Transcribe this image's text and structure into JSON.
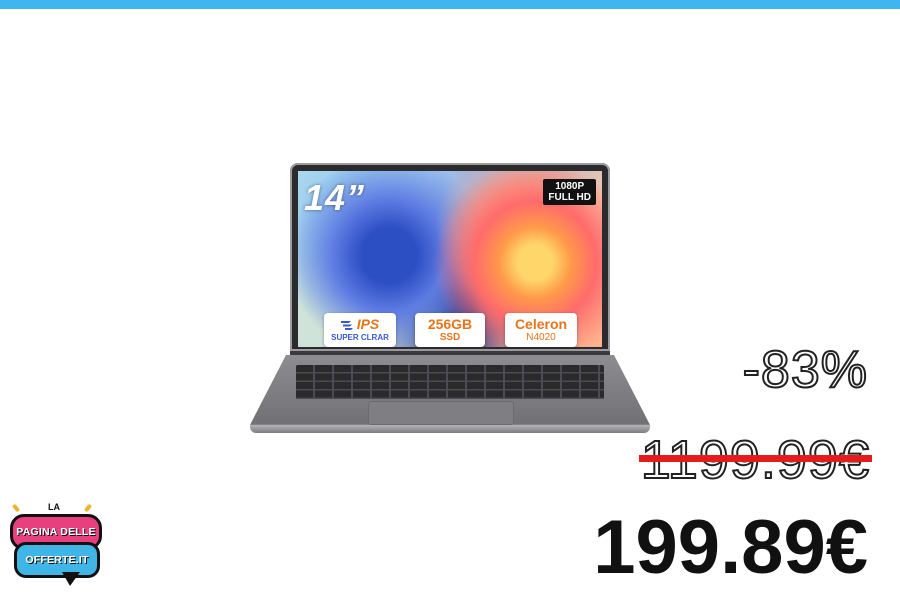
{
  "colors": {
    "top_bar": "#3fb6f0",
    "strike_line": "#e41c1c",
    "logo_pink": "#e8407e",
    "logo_blue": "#3fb6e6"
  },
  "product_image": {
    "screen_size": "14”",
    "resolution_line1": "1080P",
    "resolution_line2": "FULL HD",
    "spec_badges": [
      {
        "icon": "ips-wing-icon",
        "main": "IPS",
        "sub": "SUPER CLRAR"
      },
      {
        "main": "256GB",
        "sub": "SSD"
      },
      {
        "main": "Celeron",
        "sub": "N4020"
      }
    ]
  },
  "pricing": {
    "discount": "-83%",
    "original_price": "1199.99€",
    "sale_price": "199.89€"
  },
  "logo": {
    "prefix": "LA",
    "line1": "PAGINA DELLE",
    "line2": "OFFERTE.IT"
  }
}
